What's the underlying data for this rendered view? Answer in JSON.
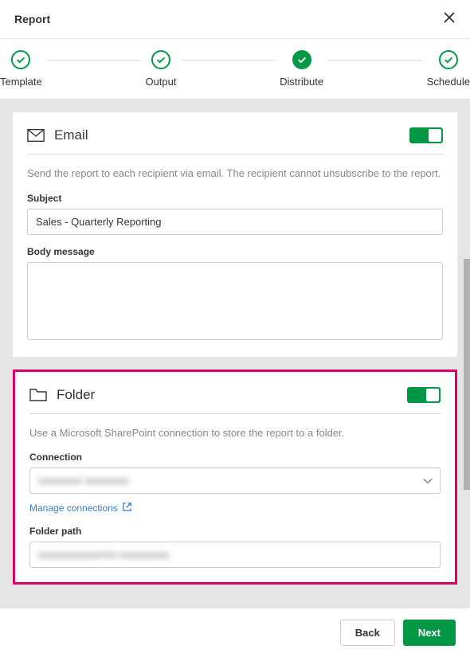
{
  "header": {
    "title": "Report"
  },
  "stepper": {
    "steps": [
      {
        "label": "Template",
        "filled": false
      },
      {
        "label": "Output",
        "filled": false
      },
      {
        "label": "Distribute",
        "filled": true
      },
      {
        "label": "Schedule",
        "filled": false
      }
    ]
  },
  "email": {
    "title": "Email",
    "description": "Send the report to each recipient via email. The recipient cannot unsubscribe to the report.",
    "subject_label": "Subject",
    "subject_value": "Sales - Quarterly Reporting",
    "body_label": "Body message",
    "body_value": ""
  },
  "folder": {
    "title": "Folder",
    "description": "Use a Microsoft SharePoint connection to store the report to a folder.",
    "connection_label": "Connection",
    "connection_value": "●●●●●●● ●●●●●●●",
    "manage_link": "Manage connections",
    "path_label": "Folder path",
    "path_value": "●●●●●●●●●●/●● ●●●●●●●●"
  },
  "footer": {
    "back": "Back",
    "next": "Next"
  }
}
